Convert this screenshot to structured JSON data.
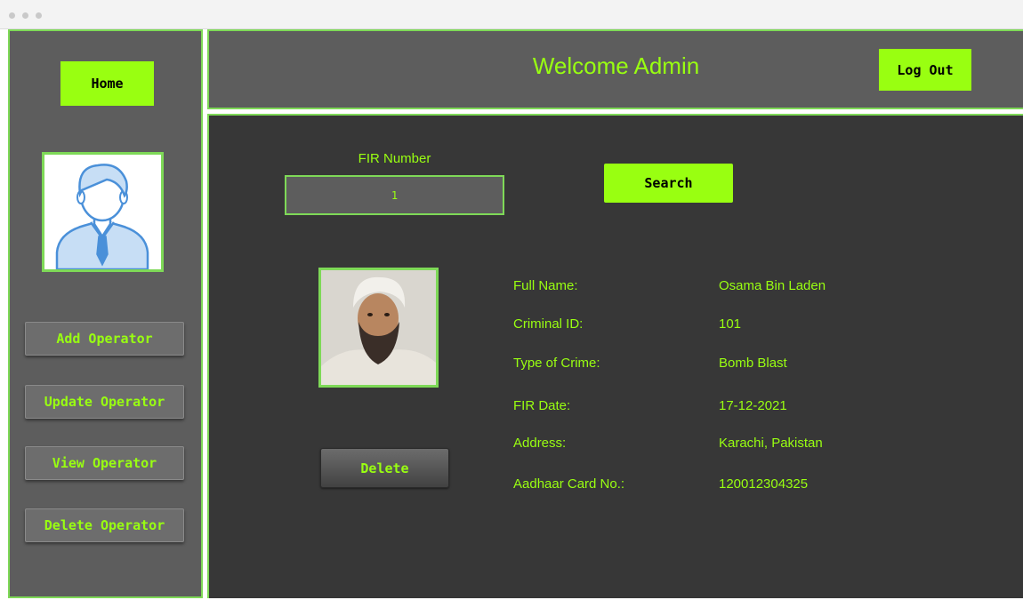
{
  "window": {
    "controls": [
      "close",
      "minimize",
      "zoom"
    ]
  },
  "sidebar": {
    "home_label": "Home",
    "avatar_icon": "user-avatar-icon",
    "items": [
      {
        "label": "Add Operator"
      },
      {
        "label": "Update Operator"
      },
      {
        "label": "View Operator"
      },
      {
        "label": "Delete Operator"
      }
    ]
  },
  "header": {
    "title": "Welcome Admin",
    "logout_label": "Log Out"
  },
  "search": {
    "field_label": "FIR Number",
    "field_value": "1",
    "button_label": "Search"
  },
  "record": {
    "photo_icon": "criminal-photo",
    "delete_label": "Delete",
    "fields": [
      {
        "label": "Full Name:",
        "value": "Osama Bin Laden"
      },
      {
        "label": "Criminal ID:",
        "value": "101"
      },
      {
        "label": "Type of Crime:",
        "value": "Bomb Blast"
      },
      {
        "label": "FIR Date:",
        "value": "17-12-2021"
      },
      {
        "label": "Address:",
        "value": "Karachi, Pakistan"
      },
      {
        "label": "Aadhaar Card No.:",
        "value": "120012304325"
      }
    ]
  },
  "colors": {
    "accent": "#99ff11",
    "border": "#7ed957",
    "panel": "#5d5d5d",
    "content_bg": "#373737"
  }
}
